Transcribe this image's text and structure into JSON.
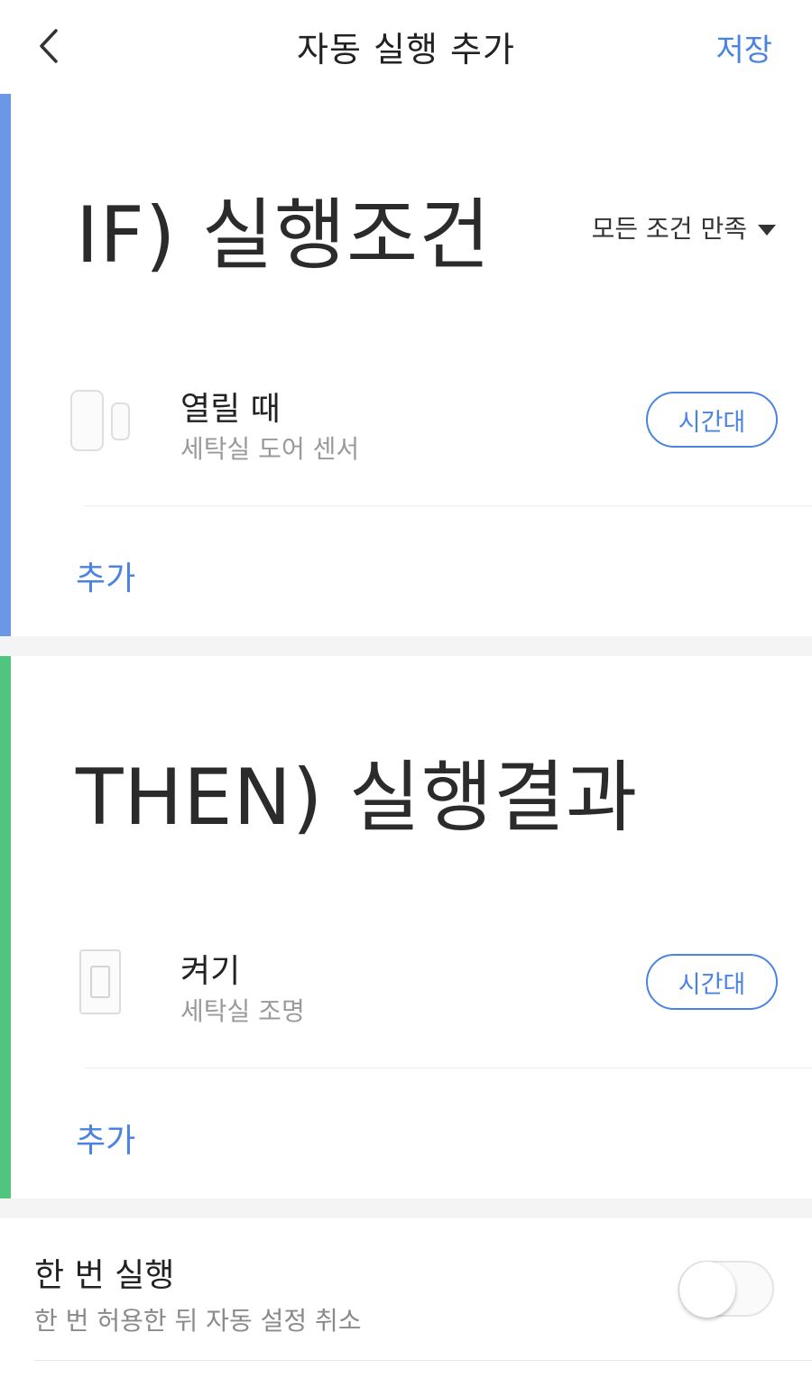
{
  "header": {
    "title": "자동 실행 추가",
    "save_label": "저장"
  },
  "if_section": {
    "title": "IF) 실행조건",
    "condition_mode": "모든 조건 만족",
    "item": {
      "title": "열릴 때",
      "subtitle": "세탁실 도어 센서",
      "time_button": "시간대"
    },
    "add_label": "추가",
    "accent_color": "#6b97e6"
  },
  "then_section": {
    "title": "THEN) 실행결과",
    "item": {
      "title": "켜기",
      "subtitle": "세탁실 조명",
      "time_button": "시간대"
    },
    "add_label": "추가",
    "accent_color": "#4fc57f"
  },
  "run_once": {
    "title": "한 번 실행",
    "subtitle": "한 번 허용한 뒤 자동 설정 취소",
    "enabled": false
  },
  "colors": {
    "accent": "#4a84e0"
  },
  "icons": [
    "chevron-left-icon",
    "dropdown-triangle-icon",
    "door-sensor-icon",
    "light-switch-icon"
  ]
}
